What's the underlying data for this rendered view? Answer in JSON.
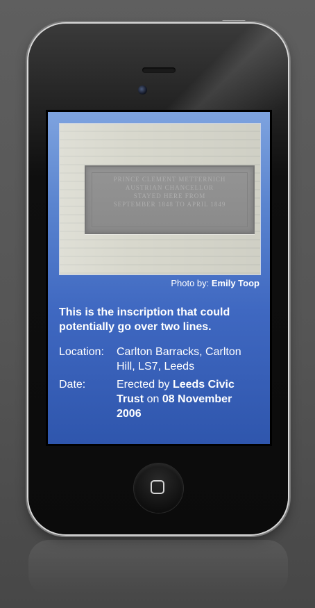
{
  "photo": {
    "caption_prefix": "Photo by: ",
    "credit": "Emily Toop",
    "plaque_lines": [
      "PRINCE CLEMENT METTERNICH",
      "AUSTRIAN CHANCELLOR",
      "STAYED HERE FROM",
      "SEPTEMBER 1848 TO APRIL 1849"
    ]
  },
  "details": {
    "inscription": "This is the inscription that could potentially go over two lines.",
    "location_label": "Location:",
    "location_value": "Carlton Barracks, Carlton Hill, LS7, Leeds",
    "date_label": "Date:",
    "date_prefix": "Erected by ",
    "date_org": "Leeds Civic Trust",
    "date_middle": " on ",
    "date_value": "08 November 2006"
  },
  "device": {
    "home_icon": "home-button-icon",
    "camera_icon": "front-camera-icon"
  }
}
